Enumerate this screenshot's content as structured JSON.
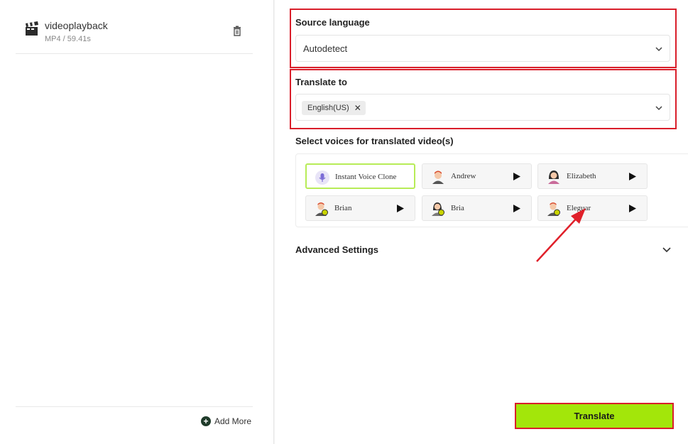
{
  "file": {
    "name": "videoplayback",
    "meta": "MP4 / 59.41s"
  },
  "left_footer": {
    "add_more": "Add More"
  },
  "source_language": {
    "label": "Source language",
    "value": "Autodetect"
  },
  "translate_to": {
    "label": "Translate to",
    "tags": [
      "English(US)"
    ]
  },
  "voices": {
    "label": "Select voices for translated video(s)",
    "items": [
      {
        "name": "Instant Voice Clone",
        "selected": true
      },
      {
        "name": "Andrew",
        "selected": false
      },
      {
        "name": "Elizabeth",
        "selected": false
      },
      {
        "name": "Brian",
        "selected": false
      },
      {
        "name": "Bria",
        "selected": false
      },
      {
        "name": "Eleguar",
        "selected": false
      }
    ]
  },
  "advanced": {
    "label": "Advanced Settings"
  },
  "actions": {
    "translate_label": "Translate"
  },
  "colors": {
    "accent_green": "#a3e60a",
    "highlight_red": "#d91e2a",
    "selected_border": "#b7ec57"
  },
  "icons": {
    "file": "clapperboard-icon",
    "trash": "trash-icon",
    "add": "plus-circle-icon",
    "chevron": "chevron-down-icon",
    "remove_tag": "close-icon",
    "play": "play-icon"
  }
}
